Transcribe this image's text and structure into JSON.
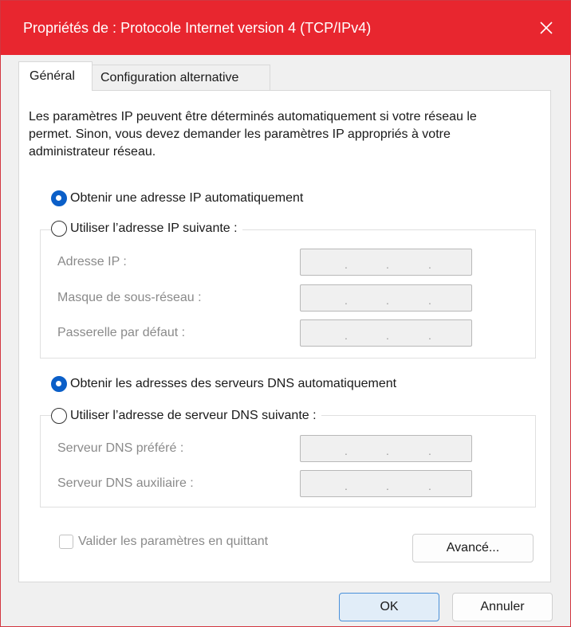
{
  "window": {
    "title": "Propriétés de : Protocole Internet version 4 (TCP/IPv4)",
    "close_icon": "close-icon"
  },
  "tabs": [
    {
      "label": "Général",
      "active": true
    },
    {
      "label": "Configuration alternative",
      "active": false
    }
  ],
  "general": {
    "description": "Les paramètres IP peuvent être déterminés automatiquement si votre réseau le permet. Sinon, vous devez demander les paramètres IP appropriés à votre administrateur réseau.",
    "ip": {
      "auto_label": "Obtenir une adresse IP automatiquement",
      "manual_label": "Utiliser l’adresse IP suivante :",
      "selected": "auto",
      "fields": [
        {
          "label": "Adresse IP :",
          "value": ". . ."
        },
        {
          "label": "Masque de sous-réseau :",
          "value": ". . ."
        },
        {
          "label": "Passerelle par défaut :",
          "value": ". . ."
        }
      ]
    },
    "dns": {
      "auto_label": "Obtenir les adresses des serveurs DNS automatiquement",
      "manual_label": "Utiliser l’adresse de serveur DNS suivante :",
      "selected": "auto",
      "fields": [
        {
          "label": "Serveur DNS préféré :",
          "value": ". . ."
        },
        {
          "label": "Serveur DNS auxiliaire :",
          "value": ". . ."
        }
      ]
    },
    "validate_label": "Valider les paramètres en quittant",
    "validate_checked": false,
    "advanced_label": "Avancé..."
  },
  "footer": {
    "ok_label": "OK",
    "cancel_label": "Annuler"
  },
  "colors": {
    "titlebar": "#e8262f",
    "radio_accent": "#0b5fc8",
    "primary_button_border": "#4a90d9"
  }
}
